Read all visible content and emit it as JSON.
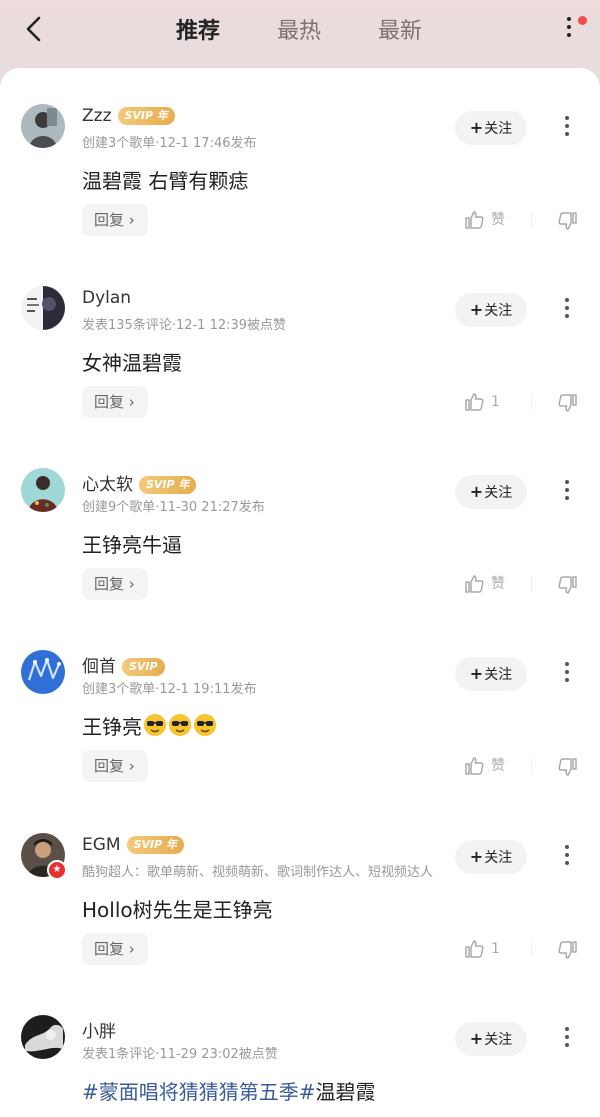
{
  "header": {
    "tabs": [
      "推荐",
      "最热",
      "最新"
    ],
    "active_tab": "推荐"
  },
  "colors": {
    "accent_vip": "#e7ad4e",
    "notification_dot": "#f04c4c",
    "hashtag": "#3a5b9c"
  },
  "comments": [
    {
      "name": "Zzz",
      "vip": "SVIP 年",
      "meta": "创建3个歌单·12-1 17:46发布",
      "text": "温碧霞  右臂有颗痣",
      "reply": "回复",
      "like": "赞",
      "follow": "关注",
      "avatar": "avatar-photo-person"
    },
    {
      "name": "Dylan",
      "vip": "",
      "meta": "发表135条评论·12-1 12:39被点赞",
      "text": "女神温碧霞",
      "reply": "回复",
      "like": "1",
      "follow": "关注",
      "avatar": "avatar-photo-dark"
    },
    {
      "name": "心太软",
      "vip": "SVIP 年",
      "meta": "创建9个歌单·11-30 21:27发布",
      "text": "王铮亮牛逼",
      "reply": "回复",
      "like": "赞",
      "follow": "关注",
      "avatar": "avatar-photo-person"
    },
    {
      "name": "佪首",
      "vip": "SVIP",
      "meta": "创建3个歌单·12-1 19:11发布",
      "text": "王铮亮",
      "emojis": 3,
      "reply": "回复",
      "like": "赞",
      "follow": "关注",
      "avatar": "avatar-blue-logo"
    },
    {
      "name": "EGM",
      "vip": "SVIP 年",
      "meta": "酷狗超人：歌单萌新、视频萌新、歌词制作达人、短视频达人",
      "text": "Hollo树先生是王铮亮",
      "reply": "回复",
      "like": "1",
      "follow": "关注",
      "avatar": "avatar-photo-person",
      "star_badge": true
    },
    {
      "name": "小胖",
      "vip": "",
      "meta": "发表1条评论·11-29 23:02被点赞",
      "text_tag": "#蒙面唱将猜猜猜第五季#",
      "text": "温碧霞",
      "follow": "关注",
      "avatar": "avatar-photo-bw"
    }
  ]
}
